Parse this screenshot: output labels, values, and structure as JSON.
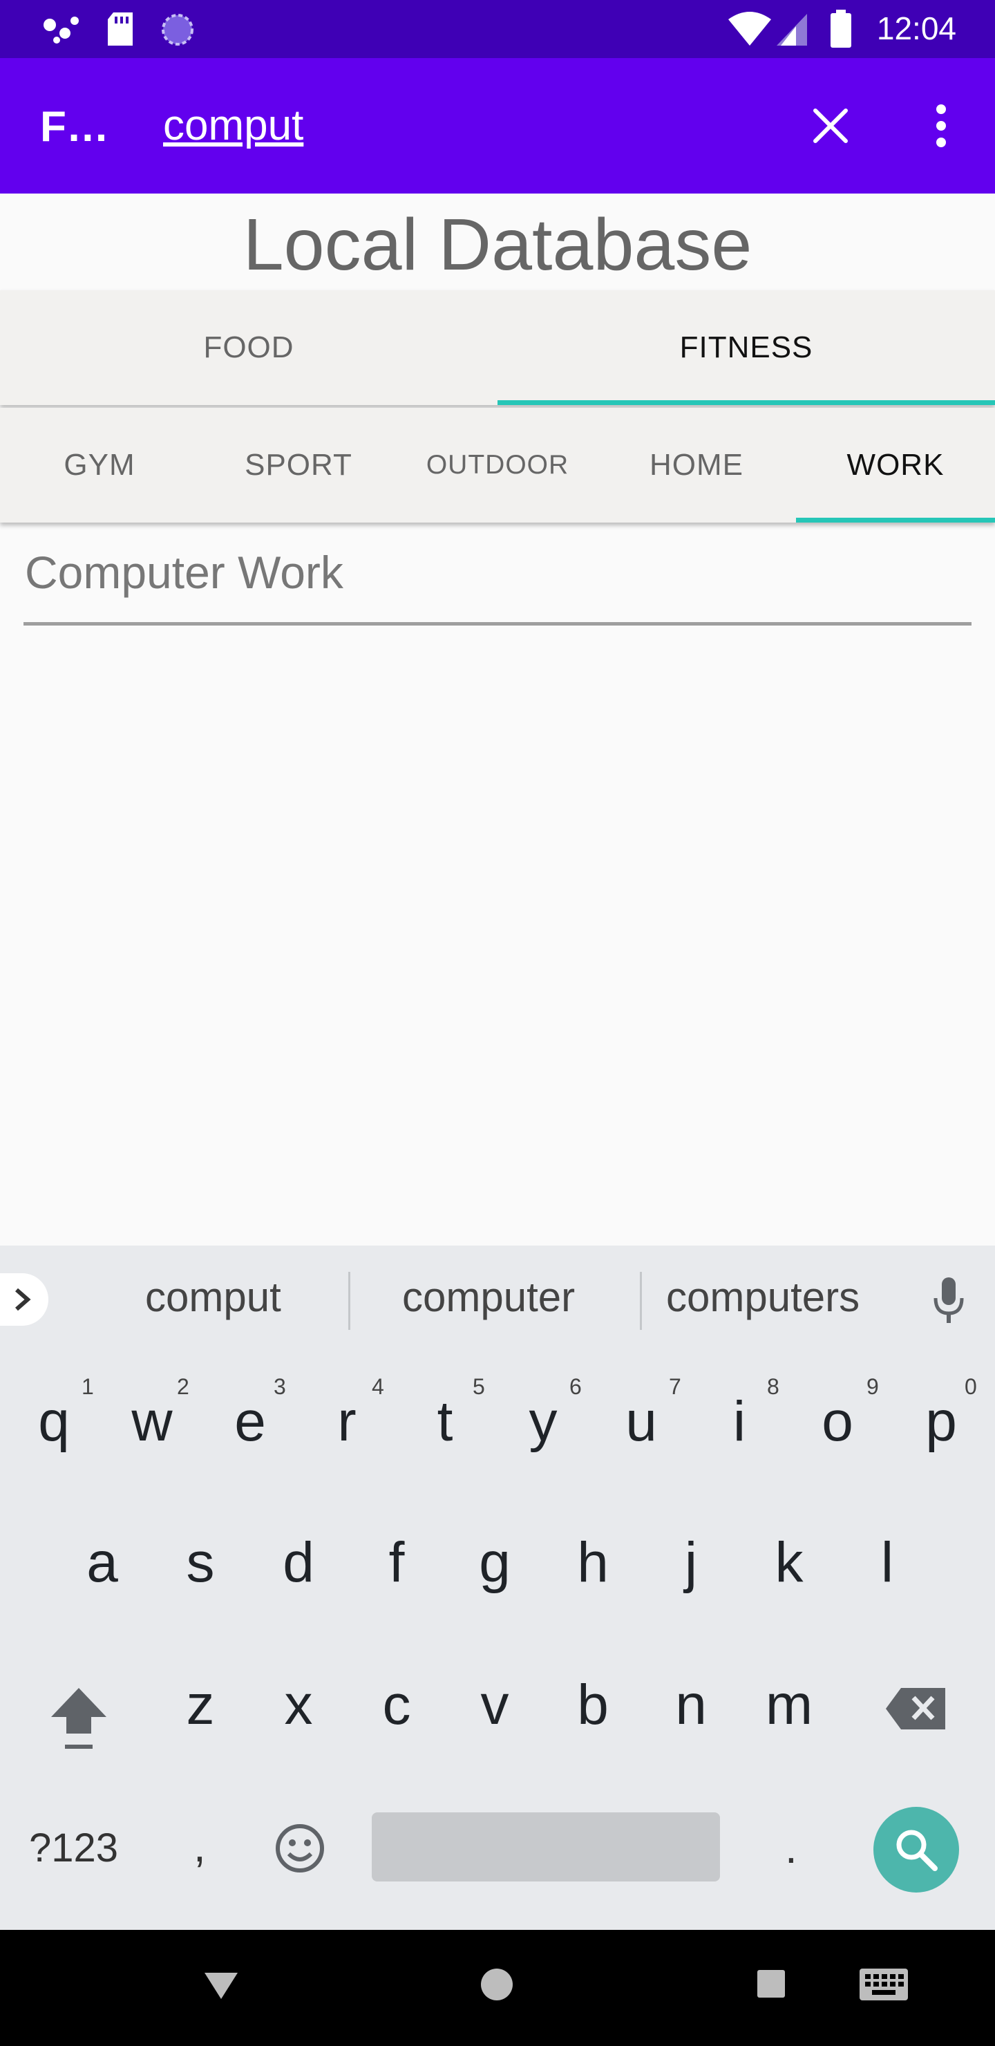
{
  "status_bar": {
    "time": "12:04"
  },
  "app_bar": {
    "title": "F…",
    "query": "comput"
  },
  "header": {
    "text": "Local Database"
  },
  "tabs_primary": [
    {
      "label": "FOOD",
      "active": false
    },
    {
      "label": "FITNESS",
      "active": true
    }
  ],
  "tabs_secondary": [
    {
      "label": "GYM",
      "active": false
    },
    {
      "label": "SPORT",
      "active": false
    },
    {
      "label": "OUTDOOR",
      "active": false
    },
    {
      "label": "HOME",
      "active": false
    },
    {
      "label": "WORK",
      "active": true
    }
  ],
  "results": [
    {
      "label": "Computer Work"
    }
  ],
  "keyboard": {
    "suggestions": [
      "comput",
      "computer",
      "computers"
    ],
    "row1": [
      "q",
      "w",
      "e",
      "r",
      "t",
      "y",
      "u",
      "i",
      "o",
      "p"
    ],
    "row1_hints": [
      "1",
      "2",
      "3",
      "4",
      "5",
      "6",
      "7",
      "8",
      "9",
      "0"
    ],
    "row2": [
      "a",
      "s",
      "d",
      "f",
      "g",
      "h",
      "j",
      "k",
      "l"
    ],
    "row3": [
      "z",
      "x",
      "c",
      "v",
      "b",
      "n",
      "m"
    ],
    "symbols_key": "?123",
    "comma_key": ",",
    "period_key": "."
  },
  "colors": {
    "status_bar": "#3f00b5",
    "app_bar": "#6200ee",
    "tab_indicator": "#26c6b7",
    "search_key": "#4db6ac"
  }
}
